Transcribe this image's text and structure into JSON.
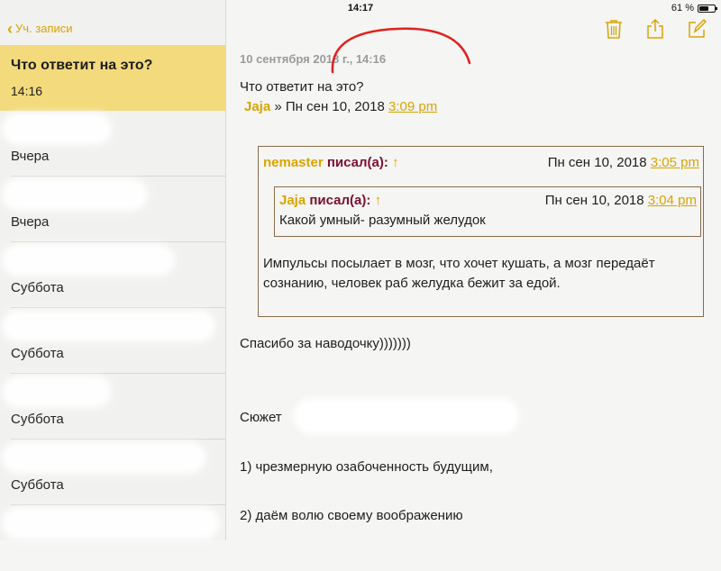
{
  "status_bar": {
    "device": "iPad",
    "time": "14:17",
    "battery": "61 %",
    "battery_fraction": 0.61
  },
  "sidebar": {
    "back_label": "Уч. записи",
    "selected_note": {
      "title": "Что ответит на это?",
      "time": "14:16"
    },
    "items": [
      {
        "date": "Вчера"
      },
      {
        "date": "Вчера"
      },
      {
        "date": "Суббота"
      },
      {
        "date": "Суббота"
      },
      {
        "date": "Суббота"
      },
      {
        "date": "Суббота"
      }
    ]
  },
  "toolbar": {
    "icons": [
      "trash-icon",
      "share-icon",
      "compose-icon"
    ]
  },
  "note": {
    "timestamp": "10 сентября 2018 г., 14:16",
    "heading": "Что ответит на это?",
    "byline": {
      "author": "Jaja",
      "sep": " » ",
      "date": "Пн сен 10, 2018 ",
      "time": "3:09 pm"
    },
    "quote": {
      "author": "nemaster",
      "wrote": " писал(а):",
      "arrow": "↑",
      "date": "Пн сен 10, 2018 ",
      "time": "3:05 pm",
      "inner": {
        "author": "Jaja",
        "wrote": " писал(а):",
        "arrow": "↑",
        "date": "Пн сен 10, 2018 ",
        "time": "3:04 pm",
        "text": "Какой умный- разумный желудок"
      },
      "text": "Импульсы посылает в мозг, что хочет кушать, а мозг передаёт сознанию, человек раб желудка бежит за едой."
    },
    "thanks": "Спасибо за наводочку)))))))",
    "plot_label": "Сюжет",
    "list": [
      "1) чрезмерную озабоченность будущим,",
      "2) даём волю своему воображению"
    ]
  },
  "colors": {
    "accent": "#d9a400",
    "selected_bg": "#f3da7c",
    "maroon": "#7a1030",
    "annotation": "#e0201e"
  }
}
